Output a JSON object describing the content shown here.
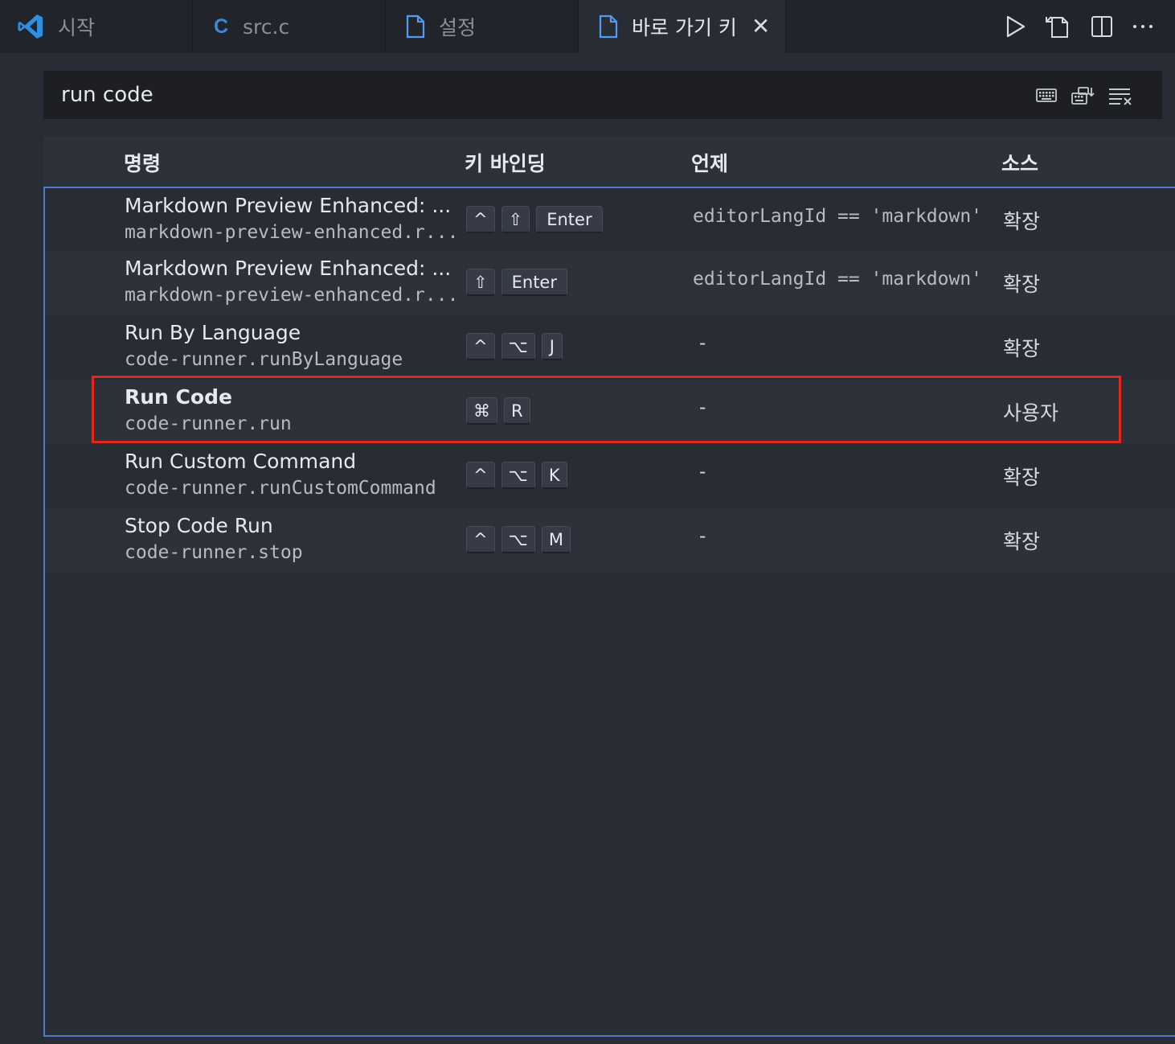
{
  "tabs": [
    {
      "label": "시작",
      "icon": "vscode-logo-icon"
    },
    {
      "label": "src.c",
      "icon": "c-file-icon"
    },
    {
      "label": "설정",
      "icon": "file-icon"
    },
    {
      "label": "바로 가기 키",
      "icon": "file-icon",
      "active": true,
      "close": "✕"
    }
  ],
  "editor_actions": [
    "run-icon",
    "open-json-icon",
    "split-editor-icon",
    "more-actions-icon"
  ],
  "search": {
    "value": "run code",
    "icons": [
      "record-keys-icon",
      "sort-by-precedence-icon",
      "clear-filter-icon"
    ]
  },
  "table": {
    "headers": {
      "command": "명령",
      "keybinding": "키 바인딩",
      "when": "언제",
      "source": "소스"
    },
    "rows": [
      {
        "title": "Markdown Preview Enhanced: ...",
        "id": "markdown-preview-enhanced.r...",
        "keys": [
          "^",
          "⇧",
          "Enter"
        ],
        "when": "editorLangId == 'markdown'",
        "source": "확장"
      },
      {
        "title": "Markdown Preview Enhanced: ...",
        "id": "markdown-preview-enhanced.r...",
        "keys": [
          "⇧",
          "Enter"
        ],
        "when": "editorLangId == 'markdown'",
        "source": "확장"
      },
      {
        "title": "Run By Language",
        "id": "code-runner.runByLanguage",
        "keys": [
          "^",
          "⌥",
          "J"
        ],
        "when": "-",
        "source": "확장"
      },
      {
        "title": "Run Code",
        "id": "code-runner.run",
        "keys": [
          "⌘",
          "R"
        ],
        "when": "-",
        "source": "사용자",
        "highlighted": true
      },
      {
        "title": "Run Custom Command",
        "id": "code-runner.runCustomCommand",
        "keys": [
          "^",
          "⌥",
          "K"
        ],
        "when": "-",
        "source": "확장"
      },
      {
        "title": "Stop Code Run",
        "id": "code-runner.stop",
        "keys": [
          "^",
          "⌥",
          "M"
        ],
        "when": "-",
        "source": "확장"
      }
    ]
  },
  "colors": {
    "background": "#282c34",
    "tabbar": "#21252b",
    "focus_border": "#4d78cc",
    "highlight_border": "#e3281b",
    "vscode_blue": "#3f9de9"
  }
}
